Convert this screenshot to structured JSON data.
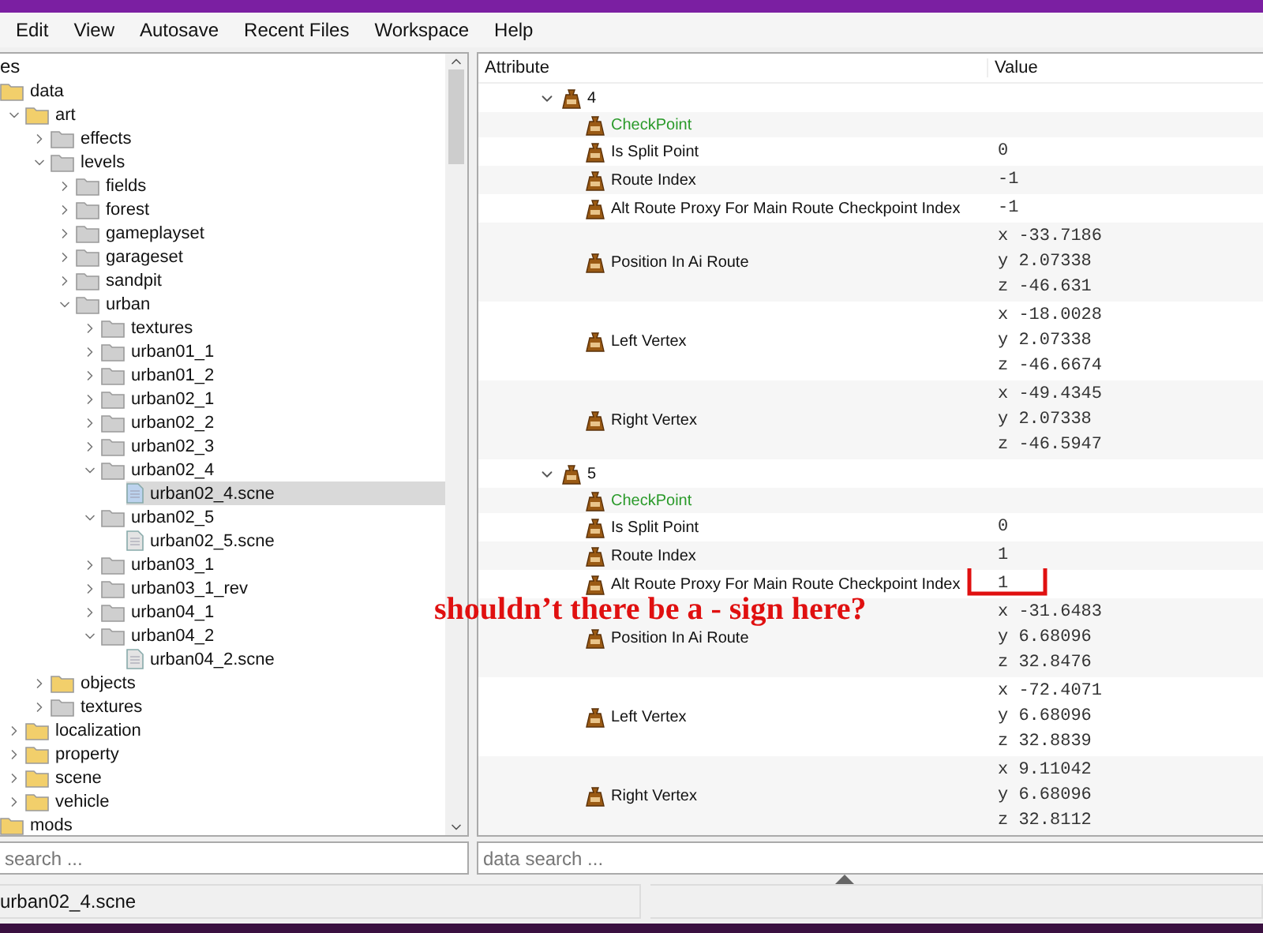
{
  "menu": [
    "Edit",
    "View",
    "Autosave",
    "Recent Files",
    "Workspace",
    "Help"
  ],
  "files": {
    "header": "es",
    "search": {
      "placeholder": "search ..."
    },
    "tree": [
      {
        "label": "data",
        "kind": "folder",
        "color": "#f2cf6b",
        "selected": false,
        "children": [
          {
            "label": "art",
            "kind": "folder",
            "color": "#f2cf6b",
            "expanded": true,
            "selected": false,
            "children": [
              {
                "label": "effects",
                "kind": "folder",
                "color": "#cfcfcf",
                "expanded": false,
                "selected": false
              },
              {
                "label": "levels",
                "kind": "folder",
                "color": "#cfcfcf",
                "expanded": true,
                "selected": false,
                "children": [
                  {
                    "label": "fields",
                    "kind": "folder",
                    "color": "#cfcfcf",
                    "expanded": false,
                    "selected": false
                  },
                  {
                    "label": "forest",
                    "kind": "folder",
                    "color": "#cfcfcf",
                    "expanded": false,
                    "selected": false
                  },
                  {
                    "label": "gameplayset",
                    "kind": "folder",
                    "color": "#cfcfcf",
                    "expanded": false,
                    "selected": false
                  },
                  {
                    "label": "garageset",
                    "kind": "folder",
                    "color": "#cfcfcf",
                    "expanded": false,
                    "selected": false
                  },
                  {
                    "label": "sandpit",
                    "kind": "folder",
                    "color": "#cfcfcf",
                    "expanded": false,
                    "selected": false
                  },
                  {
                    "label": "urban",
                    "kind": "folder",
                    "color": "#cfcfcf",
                    "expanded": true,
                    "selected": false,
                    "children": [
                      {
                        "label": "textures",
                        "kind": "folder",
                        "color": "#cfcfcf",
                        "expanded": false,
                        "selected": false
                      },
                      {
                        "label": "urban01_1",
                        "kind": "folder",
                        "color": "#cfcfcf",
                        "expanded": false,
                        "selected": false
                      },
                      {
                        "label": "urban01_2",
                        "kind": "folder",
                        "color": "#cfcfcf",
                        "expanded": false,
                        "selected": false
                      },
                      {
                        "label": "urban02_1",
                        "kind": "folder",
                        "color": "#cfcfcf",
                        "expanded": false,
                        "selected": false
                      },
                      {
                        "label": "urban02_2",
                        "kind": "folder",
                        "color": "#cfcfcf",
                        "expanded": false,
                        "selected": false
                      },
                      {
                        "label": "urban02_3",
                        "kind": "folder",
                        "color": "#cfcfcf",
                        "expanded": false,
                        "selected": false
                      },
                      {
                        "label": "urban02_4",
                        "kind": "folder",
                        "color": "#cfcfcf",
                        "expanded": true,
                        "selected": false,
                        "children": [
                          {
                            "label": "urban02_4.scne",
                            "kind": "file",
                            "color": "#bcd3ee",
                            "selected": true
                          }
                        ]
                      },
                      {
                        "label": "urban02_5",
                        "kind": "folder",
                        "color": "#cfcfcf",
                        "expanded": true,
                        "selected": false,
                        "children": [
                          {
                            "label": "urban02_5.scne",
                            "kind": "file",
                            "color": "#e4e4e4",
                            "selected": false
                          }
                        ]
                      },
                      {
                        "label": "urban03_1",
                        "kind": "folder",
                        "color": "#cfcfcf",
                        "expanded": false,
                        "selected": false
                      },
                      {
                        "label": "urban03_1_rev",
                        "kind": "folder",
                        "color": "#cfcfcf",
                        "expanded": false,
                        "selected": false
                      },
                      {
                        "label": "urban04_1",
                        "kind": "folder",
                        "color": "#cfcfcf",
                        "expanded": false,
                        "selected": false
                      },
                      {
                        "label": "urban04_2",
                        "kind": "folder",
                        "color": "#cfcfcf",
                        "expanded": true,
                        "selected": false,
                        "children": [
                          {
                            "label": "urban04_2.scne",
                            "kind": "file",
                            "color": "#e4e4e4",
                            "selected": false
                          }
                        ]
                      }
                    ]
                  }
                ]
              },
              {
                "label": "objects",
                "kind": "folder",
                "color": "#f2cf6b",
                "expanded": false,
                "selected": false
              },
              {
                "label": "textures",
                "kind": "folder",
                "color": "#cfcfcf",
                "expanded": false,
                "selected": false
              }
            ]
          },
          {
            "label": "localization",
            "kind": "folder",
            "color": "#f2cf6b",
            "expanded": false,
            "selected": false
          },
          {
            "label": "property",
            "kind": "folder",
            "color": "#f2cf6b",
            "expanded": false,
            "selected": false
          },
          {
            "label": "scene",
            "kind": "folder",
            "color": "#f2cf6b",
            "expanded": false,
            "selected": false
          },
          {
            "label": "vehicle",
            "kind": "folder",
            "color": "#f2cf6b",
            "expanded": false,
            "selected": false
          }
        ]
      },
      {
        "label": "mods",
        "kind": "folder",
        "color": "#f2cf6b",
        "selected": false
      }
    ]
  },
  "attributes": {
    "columns": [
      "Attribute",
      "Value"
    ],
    "search": {
      "placeholder": "data search ..."
    },
    "groups": [
      {
        "label": "4",
        "expanded": true,
        "rows": [
          {
            "kind": "type",
            "label": "CheckPoint"
          },
          {
            "kind": "text",
            "label": "Is Split Point",
            "value": "0"
          },
          {
            "kind": "text",
            "label": "Route Index",
            "value": "-1"
          },
          {
            "kind": "text",
            "label": "Alt Route Proxy For Main Route Checkpoint Index",
            "value": "-1"
          },
          {
            "kind": "vector",
            "label": "Position In Ai Route",
            "components": [
              {
                "axis": "x",
                "value": "-33.7186"
              },
              {
                "axis": "y",
                "value": "2.07338"
              },
              {
                "axis": "z",
                "value": "-46.631"
              }
            ]
          },
          {
            "kind": "vector",
            "label": "Left Vertex",
            "components": [
              {
                "axis": "x",
                "value": "-18.0028"
              },
              {
                "axis": "y",
                "value": "2.07338"
              },
              {
                "axis": "z",
                "value": "-46.6674"
              }
            ]
          },
          {
            "kind": "vector",
            "label": "Right Vertex",
            "components": [
              {
                "axis": "x",
                "value": "-49.4345"
              },
              {
                "axis": "y",
                "value": "2.07338"
              },
              {
                "axis": "z",
                "value": "-46.5947"
              }
            ]
          }
        ]
      },
      {
        "label": "5",
        "expanded": true,
        "rows": [
          {
            "kind": "type",
            "label": "CheckPoint"
          },
          {
            "kind": "text",
            "label": "Is Split Point",
            "value": "0"
          },
          {
            "kind": "text",
            "label": "Route Index",
            "value": "1"
          },
          {
            "kind": "text",
            "label": "Alt Route Proxy For Main Route Checkpoint Index",
            "value": "1"
          },
          {
            "kind": "vector",
            "label": "Position In Ai Route",
            "components": [
              {
                "axis": "x",
                "value": "-31.6483"
              },
              {
                "axis": "y",
                "value": "6.68096"
              },
              {
                "axis": "z",
                "value": "32.8476"
              }
            ]
          },
          {
            "kind": "vector",
            "label": "Left Vertex",
            "components": [
              {
                "axis": "x",
                "value": "-72.4071"
              },
              {
                "axis": "y",
                "value": "6.68096"
              },
              {
                "axis": "z",
                "value": "32.8839"
              }
            ]
          },
          {
            "kind": "vector",
            "label": "Right Vertex",
            "components": [
              {
                "axis": "x",
                "value": "9.11042"
              },
              {
                "axis": "y",
                "value": "6.68096"
              },
              {
                "axis": "z",
                "value": "32.8112"
              }
            ]
          }
        ]
      }
    ]
  },
  "annotation": "shouldn’t there be a - sign here?",
  "status_bar": "urban02_4.scne"
}
